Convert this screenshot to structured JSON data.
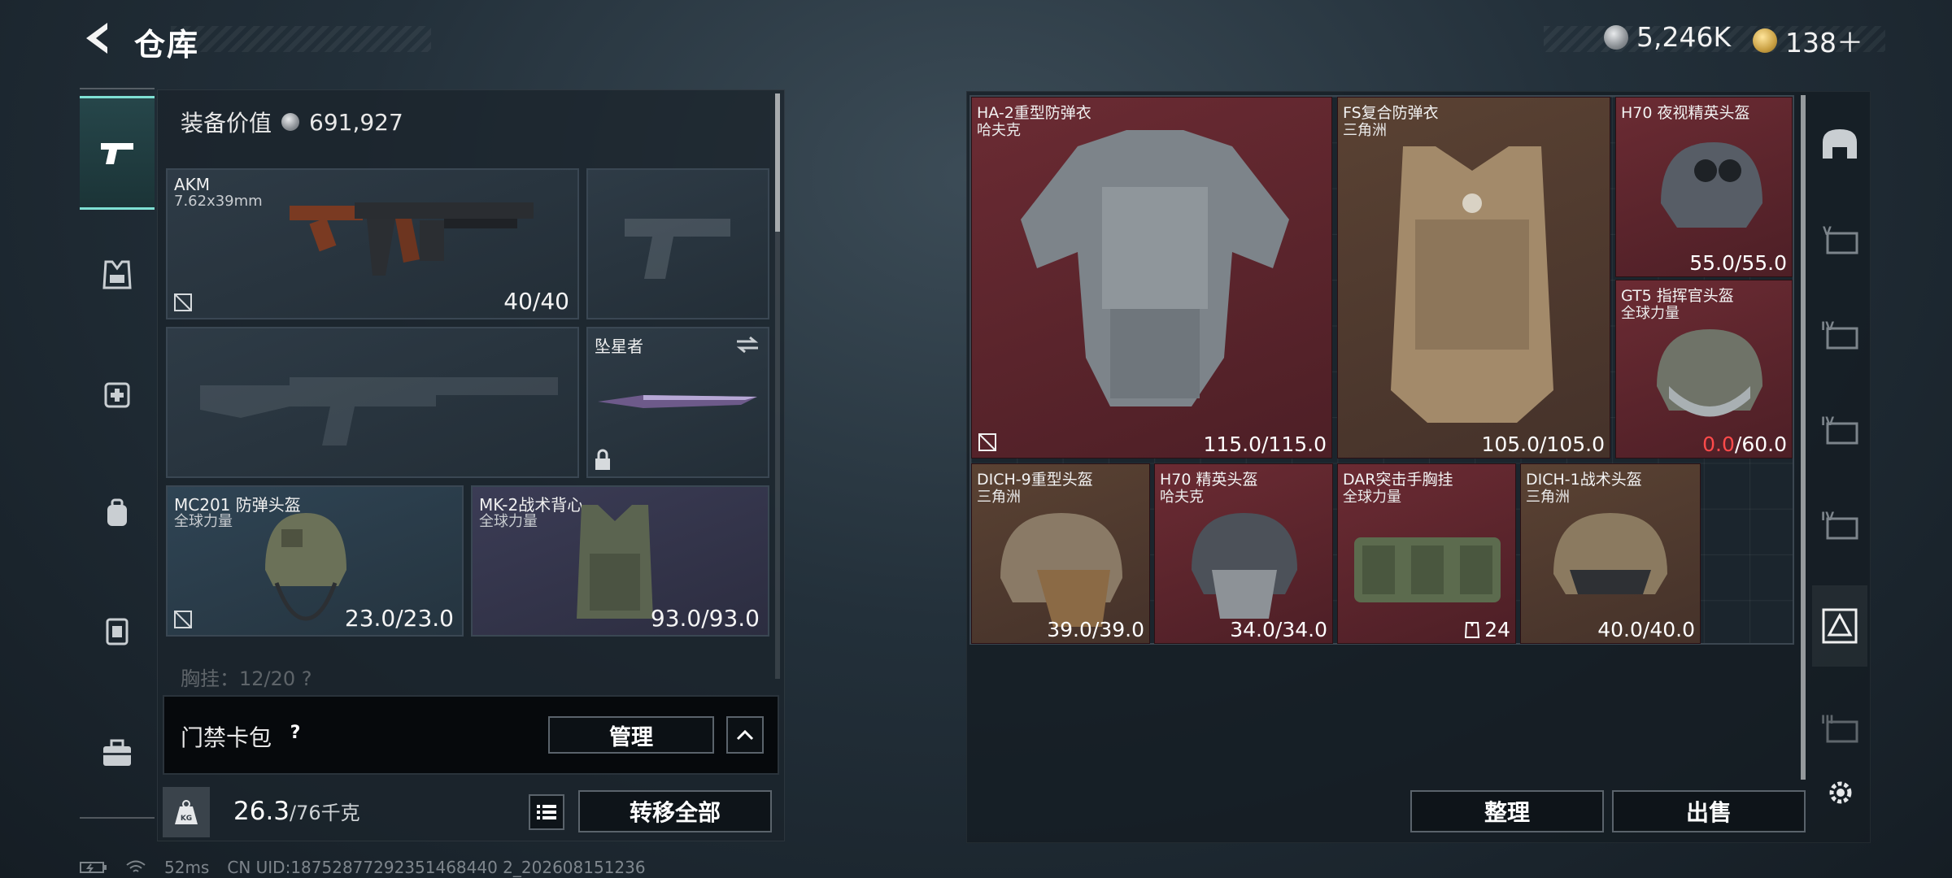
{
  "header": {
    "title": "仓库",
    "currencies": [
      {
        "icon": "silver-coin-icon",
        "value": "5,246K"
      },
      {
        "icon": "gold-coin-icon",
        "value": "138＋"
      }
    ]
  },
  "sidebar": {
    "items": [
      {
        "name": "weapons-tab",
        "icon": "pistol-icon",
        "active": true
      },
      {
        "name": "armor-tab",
        "icon": "vest-icon",
        "active": false
      },
      {
        "name": "medical-tab",
        "icon": "medkit-icon",
        "active": false
      },
      {
        "name": "backpack-tab",
        "icon": "backpack-icon",
        "active": false
      },
      {
        "name": "container-tab",
        "icon": "container-icon",
        "active": false
      },
      {
        "name": "briefcase-tab",
        "icon": "briefcase-icon",
        "active": false
      }
    ]
  },
  "loadout": {
    "equip_value_label": "装备价值",
    "equip_value": "691,927",
    "primary_weapon": {
      "name": "AKM",
      "caliber": "7.62x39mm",
      "durability": "40/40"
    },
    "melee": {
      "name": "坠星者"
    },
    "helmet": {
      "name": "MC201 防弹头盔",
      "brand": "全球力量",
      "durability": "23.0/23.0"
    },
    "armor": {
      "name": "MK-2战术背心",
      "brand": "全球力量",
      "durability": "93.0/93.0"
    },
    "chest_rig_partial": "胸挂：12/20 ?",
    "access_card_label": "门禁卡包",
    "help_label": "?",
    "manage_label": "管理",
    "weight_current": "26.3",
    "weight_max": "/76千克",
    "weight_icon_label": "KG",
    "transfer_all_label": "转移全部"
  },
  "status": {
    "ping": "52ms",
    "uid": "CN UID:18752877292351468440 2_202608151236"
  },
  "stash": {
    "items": [
      {
        "name": "HA-2重型防弹衣",
        "brand": "哈夫克",
        "durability": "115.0/115.0"
      },
      {
        "name": "FS复合防弹衣",
        "brand": "三角洲",
        "durability": "105.0/105.0"
      },
      {
        "name": "H70 夜视精英头盔",
        "brand": "",
        "durability": "55.0/55.0"
      },
      {
        "name": "GT5 指挥官头盔",
        "brand": "全球力量",
        "durability_current": "0.0",
        "durability_max": "/60.0"
      },
      {
        "name": "DICH-9重型头盔",
        "brand": "三角洲",
        "durability": "39.0/39.0"
      },
      {
        "name": "H70 精英头盔",
        "brand": "哈夫克",
        "durability": "34.0/34.0"
      },
      {
        "name": "DAR突击手胸挂",
        "brand": "全球力量",
        "capacity": "24"
      },
      {
        "name": "DICH-1战术头盔",
        "brand": "三角洲",
        "durability": "40.0/40.0"
      }
    ],
    "sort_label": "整理",
    "sell_label": "出售"
  },
  "right_tabs": [
    {
      "name": "filter-all-tab",
      "icon": "helmet-filter-icon"
    },
    {
      "name": "filter-tier-5-tab",
      "icon": "tier-5-icon",
      "label": "V"
    },
    {
      "name": "filter-tier-4a-tab",
      "icon": "tier-4-icon",
      "label": "IV"
    },
    {
      "name": "filter-tier-4b-tab",
      "icon": "tier-4-icon",
      "label": "IV"
    },
    {
      "name": "filter-tier-4c-tab",
      "icon": "tier-4-icon",
      "label": "IV"
    },
    {
      "name": "filter-armor-tab",
      "icon": "armor-filter-icon"
    },
    {
      "name": "filter-tier-3-tab",
      "icon": "tier-3-icon",
      "label": "III"
    }
  ]
}
